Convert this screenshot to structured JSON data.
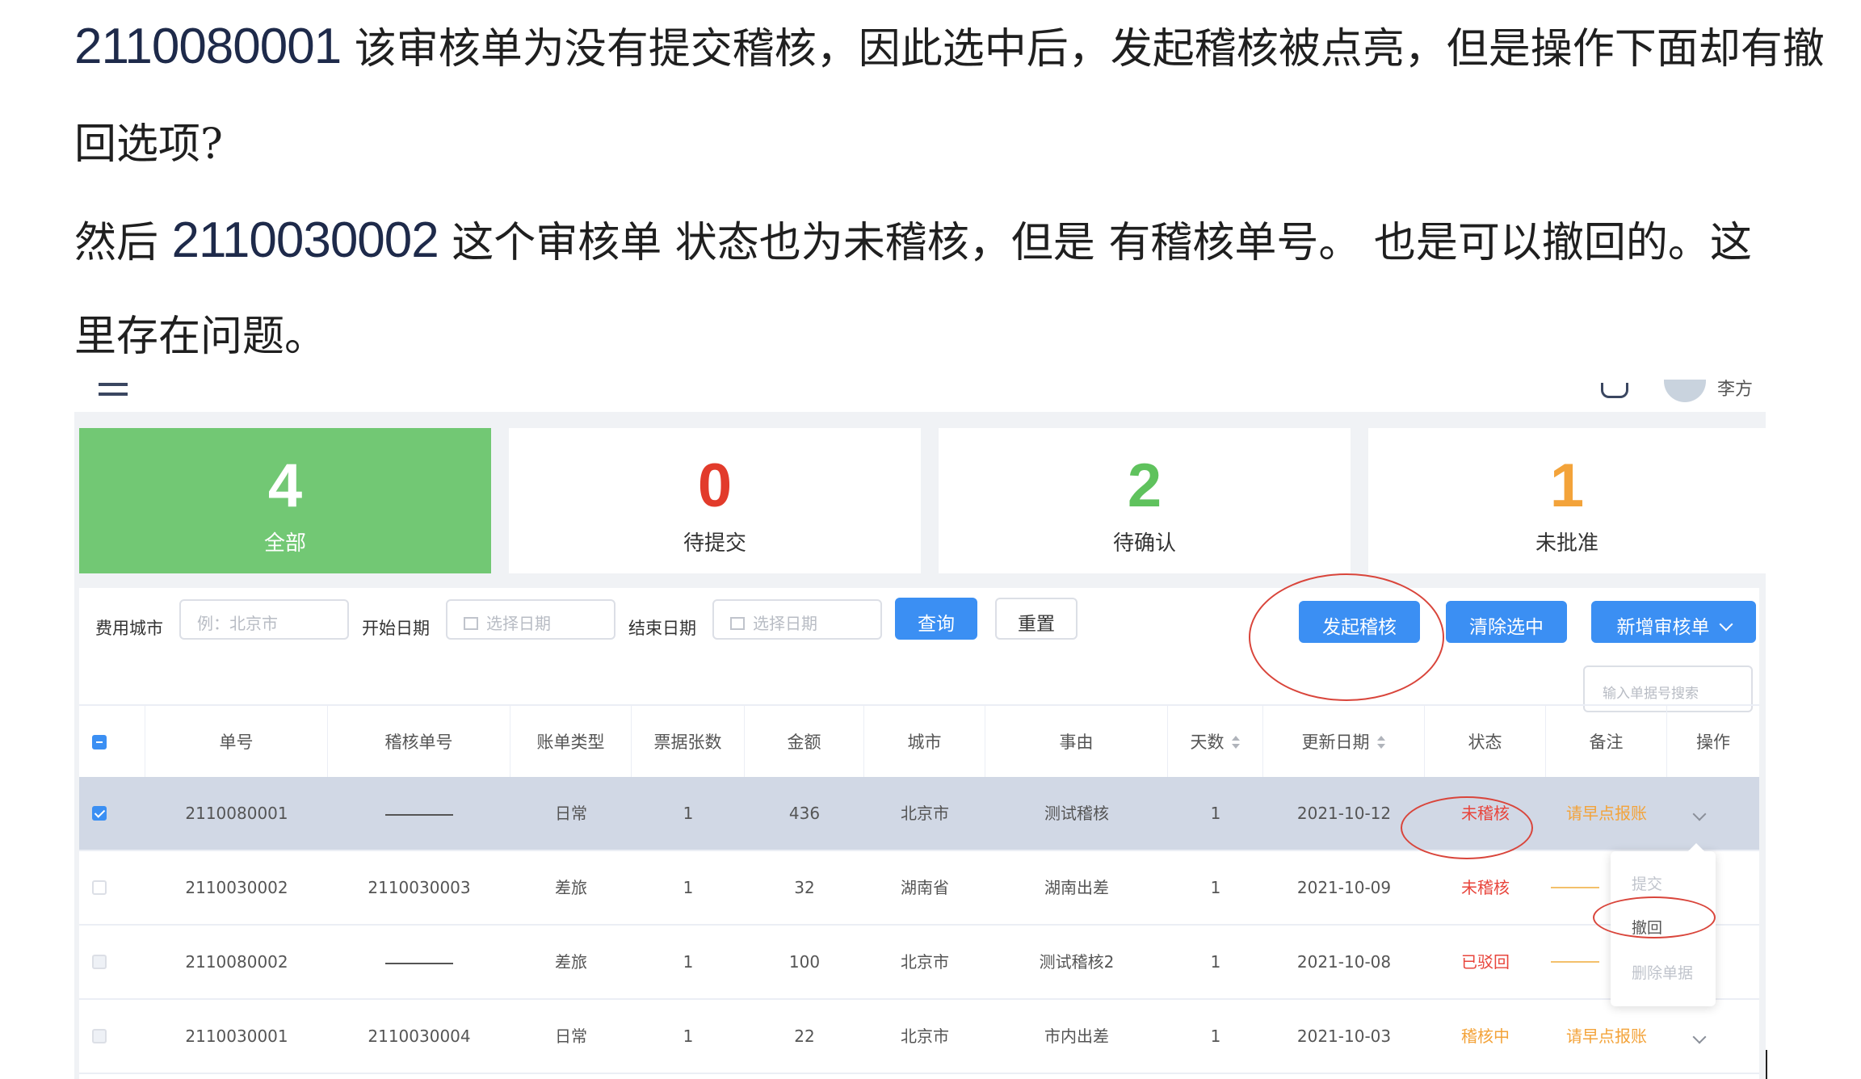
{
  "note": {
    "line1": {
      "num": "2110080001",
      "text": " 该审核单为没有提交稽核，因此选中后，发起稽核被点亮，但是操作下面却有撤"
    },
    "line2": {
      "text": "回选项?"
    },
    "line3": {
      "pre": "然后 ",
      "num": "2110030002",
      "text": " 这个审核单  状态也为未稽核，但是  有稽核单号。     也是可以撤回的。这"
    },
    "line4": {
      "text": "里存在问题。"
    }
  },
  "header": {
    "user_name": "李方"
  },
  "stats": [
    {
      "value": "4",
      "label": "全部",
      "color": "#ffffff"
    },
    {
      "value": "0",
      "label": "待提交",
      "color": "#e23b2b"
    },
    {
      "value": "2",
      "label": "待确认",
      "color": "#5fc25d"
    },
    {
      "value": "1",
      "label": "未批准",
      "color": "#f3a33a"
    }
  ],
  "filters": {
    "city_label": "费用城市",
    "city_placeholder": "例：北京市",
    "start_label": "开始日期",
    "start_placeholder": "选择日期",
    "end_label": "结束日期",
    "end_placeholder": "选择日期",
    "query_btn": "查询",
    "reset_btn": "重置"
  },
  "actions": {
    "start_audit": "发起稽核",
    "clear_selection": "清除选中",
    "new_audit": "新增审核单",
    "search_placeholder": "输入单据号搜索"
  },
  "table": {
    "columns": [
      "单号",
      "稽核单号",
      "账单类型",
      "票据张数",
      "金额",
      "城市",
      "事由",
      "天数",
      "更新日期",
      "状态",
      "备注",
      "操作"
    ],
    "rows": [
      {
        "id": "2110080001",
        "audit_no": "",
        "type": "日常",
        "count": "1",
        "amount": "436",
        "city": "北京市",
        "reason": "测试稽核",
        "days": "1",
        "date": "2021-10-12",
        "status": "未稽核",
        "remark": "请早点报账"
      },
      {
        "id": "2110030002",
        "audit_no": "2110030003",
        "type": "差旅",
        "count": "1",
        "amount": "32",
        "city": "湖南省",
        "reason": "湖南出差",
        "days": "1",
        "date": "2021-10-09",
        "status": "未稽核",
        "remark": ""
      },
      {
        "id": "2110080002",
        "audit_no": "",
        "type": "差旅",
        "count": "1",
        "amount": "100",
        "city": "北京市",
        "reason": "测试稽核2",
        "days": "1",
        "date": "2021-10-08",
        "status": "已驳回",
        "remark": ""
      },
      {
        "id": "2110030001",
        "audit_no": "2110030004",
        "type": "日常",
        "count": "1",
        "amount": "22",
        "city": "北京市",
        "reason": "市内出差",
        "days": "1",
        "date": "2021-10-03",
        "status": "稽核中",
        "remark": "请早点报账"
      }
    ]
  },
  "dropdown": {
    "submit": "提交",
    "withdraw": "撤回",
    "delete": "删除单据"
  },
  "colors": {
    "primary": "#3b8ff3",
    "success_card": "#72c874",
    "annotation": "#d9453b",
    "status_red": "#e8453c",
    "status_orange": "#f3a33a"
  }
}
